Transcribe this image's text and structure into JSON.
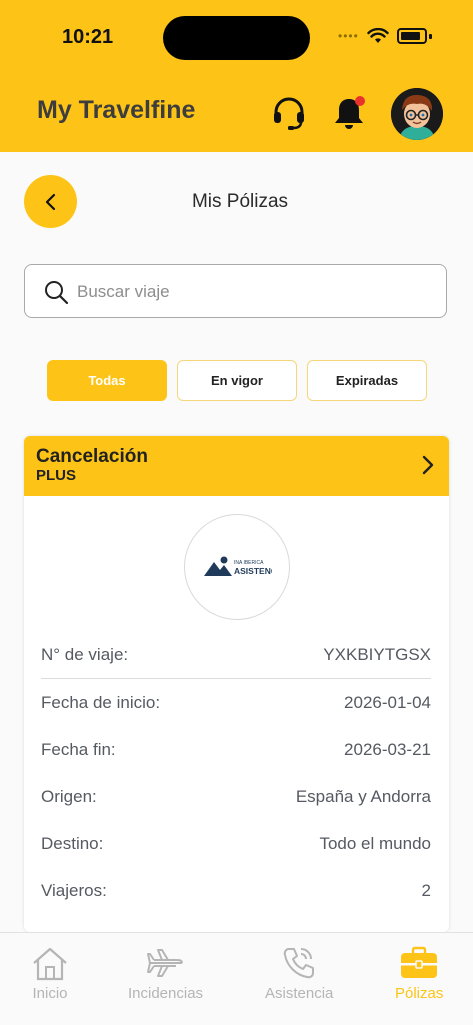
{
  "status_bar": {
    "time": "10:21"
  },
  "header": {
    "app_title": "My Travelfine",
    "colors": {
      "brand": "#fdc417",
      "notification_dot": "#e8322b"
    }
  },
  "page": {
    "title": "Mis Pólizas"
  },
  "search": {
    "placeholder": "Buscar viaje",
    "value": ""
  },
  "filters": [
    {
      "label": "Todas",
      "active": true
    },
    {
      "label": "En vigor",
      "active": false
    },
    {
      "label": "Expiradas",
      "active": false
    }
  ],
  "policy_card": {
    "title": "Cancelación",
    "subtitle": "PLUS",
    "insurer_logo": {
      "line1": "INA IBERICA",
      "line2": "ASISTENCIA"
    },
    "rows": [
      {
        "label": "N° de viaje:",
        "value": "YXKBIYTGSX"
      },
      {
        "label": "Fecha de inicio:",
        "value": "2026-01-04"
      },
      {
        "label": "Fecha fin:",
        "value": "2026-03-21"
      },
      {
        "label": "Origen:",
        "value": "España y Andorra"
      },
      {
        "label": "Destino:",
        "value": "Todo el mundo"
      },
      {
        "label": "Viajeros:",
        "value": "2"
      }
    ]
  },
  "tab_bar": {
    "items": [
      {
        "label": "Inicio",
        "icon": "home-icon",
        "active": false
      },
      {
        "label": "Incidencias",
        "icon": "airplane-icon",
        "active": false
      },
      {
        "label": "Asistencia",
        "icon": "phone-call-icon",
        "active": false
      },
      {
        "label": "Pólizas",
        "icon": "briefcase-icon",
        "active": true
      }
    ]
  }
}
